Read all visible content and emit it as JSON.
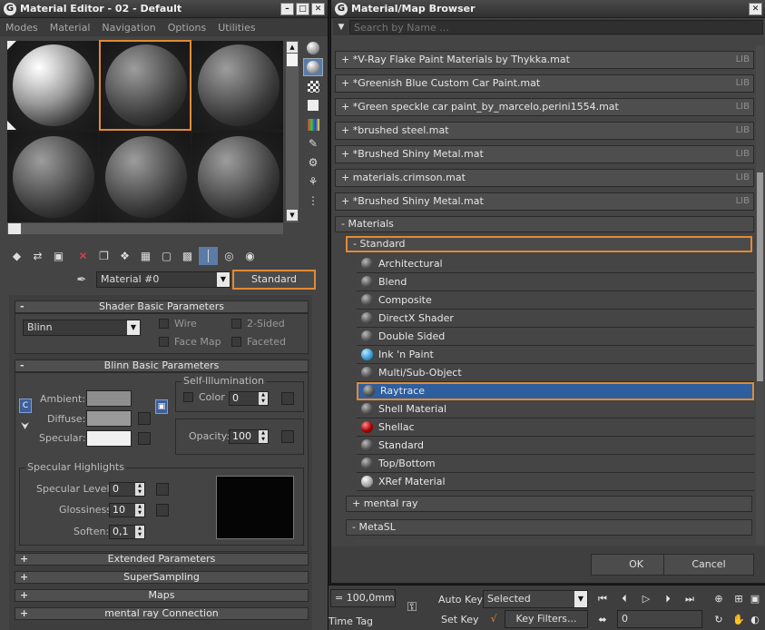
{
  "material_editor": {
    "title": "Material Editor - 02 - Default",
    "menu": [
      "Modes",
      "Material",
      "Navigation",
      "Options",
      "Utilities"
    ],
    "material_name": "Material #0",
    "material_type": "Standard",
    "shader_rollout": {
      "title": "Shader Basic Parameters",
      "shader": "Blinn",
      "checkboxes": [
        "Wire",
        "2-Sided",
        "Face Map",
        "Faceted"
      ]
    },
    "blinn_rollout": {
      "title": "Blinn Basic Parameters",
      "ambient_label": "Ambient:",
      "diffuse_label": "Diffuse:",
      "specular_label": "Specular:",
      "ambient_color": "#8e8e8e",
      "diffuse_color": "#9a9a9a",
      "specular_color": "#f0f0f0",
      "self_illum_title": "Self-Illumination",
      "color_label": "Color",
      "color_value": "0",
      "opacity_label": "Opacity:",
      "opacity_value": "100",
      "highlights_title": "Specular Highlights",
      "spec_level_label": "Specular Level:",
      "spec_level_value": "0",
      "glossiness_label": "Glossiness:",
      "glossiness_value": "10",
      "soften_label": "Soften:",
      "soften_value": "0,1",
      "lock_glyph": "C"
    },
    "collapsed_rollouts": [
      "Extended Parameters",
      "SuperSampling",
      "Maps",
      "mental ray Connection"
    ],
    "sign_minus": "-",
    "sign_plus": "+"
  },
  "browser": {
    "title": "Material/Map Browser",
    "search_placeholder": "Search by Name ...",
    "libraries": [
      "+ *V-Ray Flake Paint Materials by Thykka.mat",
      "+ *Greenish Blue Custom Car Paint.mat",
      "+ *Green speckle car paint_by_marcelo.perini1554.mat",
      "+ *brushed steel.mat",
      "+ *Brushed Shiny Metal.mat",
      "+ materials.crimson.mat",
      "+ *Brushed Shiny Metal.mat"
    ],
    "lib_tag": "LIB",
    "materials_group": "- Materials",
    "standard_group": "- Standard",
    "material_types": [
      "Architectural",
      "Blend",
      "Composite",
      "DirectX Shader",
      "Double Sided",
      "Ink 'n Paint",
      "Multi/Sub-Object",
      "Raytrace",
      "Shell Material",
      "Shellac",
      "Standard",
      "Top/Bottom",
      "XRef Material"
    ],
    "mental_ray_group": "+ mental ray",
    "metasl_group": "- MetaSL",
    "ok_label": "OK",
    "cancel_label": "Cancel"
  },
  "status_bar": {
    "coord": "= 100,0mm",
    "time_tag": "Time Tag",
    "auto_key": "Auto Key",
    "selected": "Selected",
    "set_key": "Set Key",
    "key_filters": "Key Filters...",
    "frame": "0"
  }
}
